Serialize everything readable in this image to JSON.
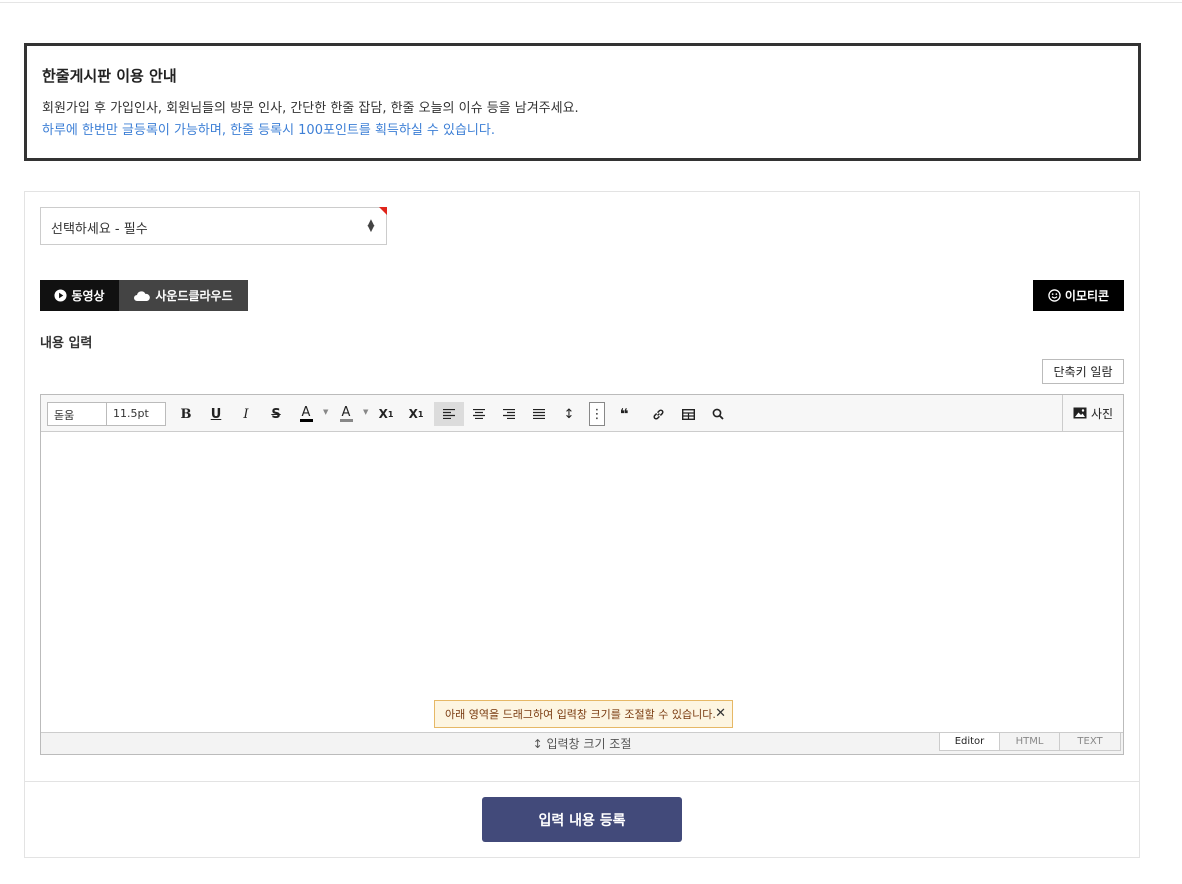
{
  "notice": {
    "title": "한줄게시판 이용 안내",
    "line1": "회원가입 후 가입인사, 회원님들의 방문 인사, 간단한 한줄 잡담, 한줄 오늘의 이슈 등을 남겨주세요.",
    "line2": "하루에 한번만 글등록이 가능하며, 한줄 등록시 100포인트를 획득하실 수 있습니다."
  },
  "category_select": {
    "value": "선택하세요 - 필수"
  },
  "media_buttons": {
    "video": "동영상",
    "soundcloud": "사운드클라우드",
    "emoticon": "이모티콘"
  },
  "content_label": "내용 입력",
  "shortcut_button": "단축키 일람",
  "editor": {
    "font_family": "돋움",
    "font_size": "11.5pt",
    "photo_button": "사진",
    "resize_tip": "아래 영역을 드래그하여 입력창 크기를 조절할 수 있습니다.",
    "resize_bar": "↕ 입력창 크기 조절",
    "modes": [
      "Editor",
      "HTML",
      "TEXT"
    ],
    "active_mode": "Editor",
    "body_text": ""
  },
  "submit_button": "입력 내용 등록",
  "colors": {
    "submit_bg": "#424a7a",
    "notice_link": "#3d7fd6",
    "required_marker": "#e0251b"
  }
}
